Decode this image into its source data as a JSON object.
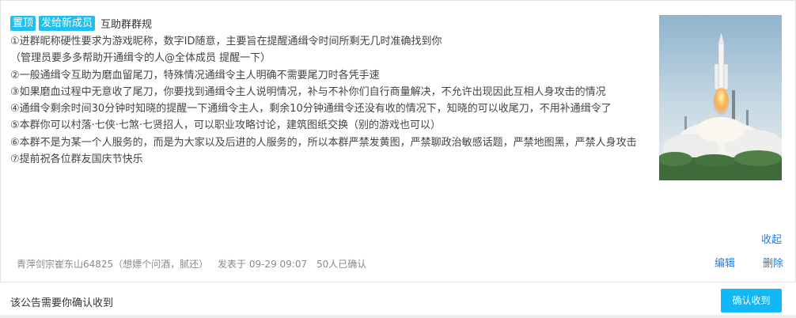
{
  "announcement": {
    "tags": [
      "置顶",
      "发给新成员"
    ],
    "title": "互助群群规",
    "lines": [
      "①进群昵称硬性要求为游戏昵称，数字ID随意，主要旨在提醒通缉令时间所剩无几时准确找到你",
      "（管理员要多多帮助开通缉令的人@全体成员 提醒一下）",
      "②一般通缉令互助为磨血留尾刀，特殊情况通缉令主人明确不需要尾刀时各凭手速",
      "③如果磨血过程中无意收了尾刀，你要找到通缉令主人说明情况，补与不补你们自行商量解决，不允许出现因此互相人身攻击的情况",
      "④通缉令剩余时间30分钟时知晓的提醒一下通缉令主人，剩余10分钟通缉令还没有收的情况下，知晓的可以收尾刀，不用补通缉令了",
      "⑤本群你可以村落·七侠·七煞·七贤招人，可以职业攻略讨论，建筑图纸交换（别的游戏也可以）",
      "⑥本群不是为某一个人服务的，而是为大家以及后进的人服务的，所以本群严禁发黄图，严禁聊政治敏感话题，严禁地图黑，严禁人身攻击",
      "⑦提前祝各位群友国庆节快乐"
    ],
    "fold_label": "收起",
    "author": "青萍剑宗崔东山64825（想嫖个问酒，腻还）",
    "posted": "发表于 09-29 09:07",
    "confirmed": "50人已确认",
    "edit_label": "编辑",
    "delete_label": "删除"
  },
  "footer": {
    "notice": "该公告需要你确认收到",
    "confirm_label": "确认收到"
  },
  "thumbnail": {
    "icon": "rocket-launch-image"
  },
  "colors": {
    "accent": "#12b7f5",
    "tag": "#1fc0ef",
    "link": "#2a7cd6"
  }
}
